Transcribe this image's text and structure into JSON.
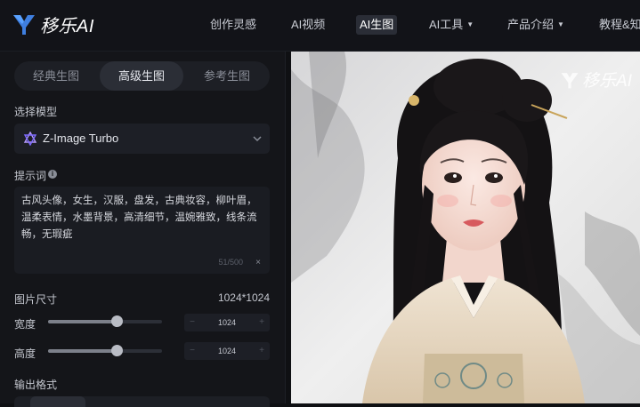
{
  "header": {
    "brand": "移乐AI",
    "nav": [
      {
        "label": "创作灵感",
        "dropdown": false,
        "active": false
      },
      {
        "label": "AI视频",
        "dropdown": false,
        "active": false
      },
      {
        "label": "AI生图",
        "dropdown": false,
        "active": true
      },
      {
        "label": "AI工具",
        "dropdown": true,
        "active": false
      },
      {
        "label": "产品介绍",
        "dropdown": true,
        "active": false
      },
      {
        "label": "教程&知",
        "dropdown": false,
        "active": false
      }
    ],
    "dropdown_glyph": "▼"
  },
  "panel": {
    "tabs": [
      "经典生图",
      "高级生图",
      "参考生图"
    ],
    "active_tab": 1,
    "model_label": "选择模型",
    "model_value": "Z-Image Turbo",
    "prompt_label": "提示词",
    "prompt_text": "古风头像，女生，汉服，盘发，古典妆容，柳叶眉，温柔表情，水墨背景，高清细节，温婉雅致，线条流畅，无瑕疵",
    "prompt_counter": "51/500",
    "clear_glyph": "×",
    "size_label": "图片尺寸",
    "size_value": "1024*1024",
    "width_label": "宽度",
    "width_value": "1024",
    "width_fraction": 0.6,
    "height_label": "高度",
    "height_value": "1024",
    "height_fraction": 0.6,
    "stepper_minus": "−",
    "stepper_plus": "+",
    "format_label": "输出格式"
  },
  "preview": {
    "watermark": "移乐AI"
  },
  "colors": {
    "background": "#0f1013",
    "panel": "#141519",
    "accent": "#2b2e36",
    "logo": "#3f7fe0"
  }
}
